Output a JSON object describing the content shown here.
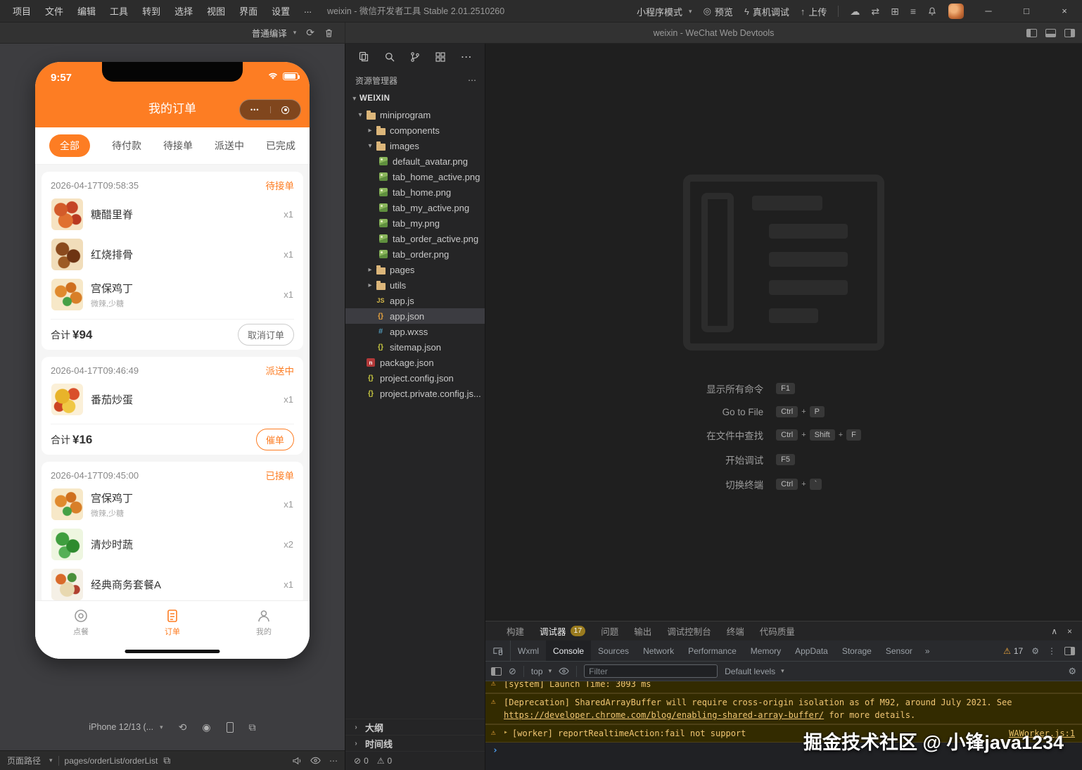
{
  "icons": {
    "chevron_down": "▾",
    "chevron_right": "▸",
    "chevron_small": "›",
    "more_h": "⋯",
    "more_v": "⋮",
    "refresh": "⟳",
    "rotate": "⟲",
    "record": "◉",
    "overlap": "⧉",
    "compare": "⇄",
    "cloud": "☁",
    "grid": "⊞",
    "menu": "≡",
    "minimize": "─",
    "maximize": "□",
    "close": "×",
    "collapse": "∧",
    "preview": "◎",
    "lightning": "ϟ",
    "upload": "↑",
    "warning": "⚠",
    "error": "⊘",
    "block": "⊘",
    "gear": "⚙",
    "more_tabs": "»",
    "prompt": "›",
    "dots": "•••"
  },
  "titlebar": {
    "menus": [
      "项目",
      "文件",
      "编辑",
      "工具",
      "转到",
      "选择",
      "视图",
      "界面",
      "设置",
      "..."
    ],
    "title": "weixin - 微信开发者工具 Stable 2.01.2510260",
    "mode_label": "小程序模式",
    "preview_label": "预览",
    "device_debug_label": "真机调试",
    "upload_label": "上传"
  },
  "toolbar": {
    "compile_mode": "普通编译",
    "devtools_title": "weixin - WeChat Web Devtools"
  },
  "phone": {
    "status_time": "9:57",
    "nav_title": "我的订单",
    "tabs": [
      "全部",
      "待付款",
      "待接单",
      "派送中",
      "已完成"
    ],
    "orders": [
      {
        "time": "2026-04-17T09:58:35",
        "status": "待接单",
        "items": [
          {
            "name": "糖醋里脊",
            "qty": "x1"
          },
          {
            "name": "红烧排骨",
            "qty": "x1"
          },
          {
            "name": "宫保鸡丁",
            "spec": "微辣,少糖",
            "qty": "x1"
          }
        ],
        "total_label": "合计",
        "total_value": "¥94",
        "action": "取消订单"
      },
      {
        "time": "2026-04-17T09:46:49",
        "status": "派送中",
        "items": [
          {
            "name": "番茄炒蛋",
            "qty": "x1"
          }
        ],
        "total_label": "合计",
        "total_value": "¥16",
        "action": "催单"
      },
      {
        "time": "2026-04-17T09:45:00",
        "status": "已接单",
        "items": [
          {
            "name": "宫保鸡丁",
            "spec": "微辣,少糖",
            "qty": "x1"
          },
          {
            "name": "清炒时蔬",
            "qty": "x2"
          },
          {
            "name": "经典商务套餐A",
            "qty": "x1"
          }
        ]
      }
    ],
    "tabbar": [
      {
        "label": "点餐"
      },
      {
        "label": "订单"
      },
      {
        "label": "我的"
      }
    ]
  },
  "sim_footer": {
    "device": "iPhone 12/13 (..."
  },
  "statusbar": {
    "path_label": "页面路径",
    "path_value": "pages/orderList/orderList"
  },
  "explorer": {
    "title": "资源管理器",
    "root": "WEIXIN",
    "items": [
      {
        "label": "miniprogram"
      },
      {
        "label": "components"
      },
      {
        "label": "images"
      },
      {
        "label": "default_avatar.png"
      },
      {
        "label": "tab_home_active.png"
      },
      {
        "label": "tab_home.png"
      },
      {
        "label": "tab_my_active.png"
      },
      {
        "label": "tab_my.png"
      },
      {
        "label": "tab_order_active.png"
      },
      {
        "label": "tab_order.png"
      },
      {
        "label": "pages"
      },
      {
        "label": "utils"
      },
      {
        "label": "app.js"
      },
      {
        "label": "app.json"
      },
      {
        "label": "app.wxss"
      },
      {
        "label": "sitemap.json"
      },
      {
        "label": "package.json"
      },
      {
        "label": "project.config.json"
      },
      {
        "label": "project.private.config.js..."
      }
    ],
    "outline_label": "大纲",
    "timeline_label": "时间线",
    "error_count": "0",
    "warning_count": "0"
  },
  "welcome": {
    "key_sep": "+",
    "shortcuts": [
      {
        "label": "显示所有命令",
        "keys": [
          "F1"
        ]
      },
      {
        "label": "Go to File",
        "keys": [
          "Ctrl",
          "P"
        ]
      },
      {
        "label": "在文件中查找",
        "keys": [
          "Ctrl",
          "Shift",
          "F"
        ]
      },
      {
        "label": "开始调试",
        "keys": [
          "F5"
        ]
      },
      {
        "label": "切换终端",
        "keys": [
          "Ctrl",
          "`"
        ]
      }
    ]
  },
  "debug": {
    "tabs": [
      "构建",
      "调试器",
      "问题",
      "输出",
      "调试控制台",
      "终端",
      "代码质量"
    ],
    "badge": "17",
    "devtools_tabs": [
      "Wxml",
      "Console",
      "Sources",
      "Network",
      "Performance",
      "Memory",
      "AppData",
      "Storage",
      "Sensor"
    ],
    "warn_count": "17",
    "context_label": "top",
    "filter_placeholder": "Filter",
    "levels_label": "Default levels",
    "console": {
      "line0": "[system] Launch Time: 3093 ms",
      "warn1_pre": "[Deprecation] SharedArrayBuffer will require cross-origin isolation as of M92, around July 2021. See ",
      "warn1_link": "https://developer.chrome.com/blog/enabling-shared-array-buffer/",
      "warn1_post": " for more details.",
      "warn2_text": "[worker] reportRealtimeAction:fail not support",
      "warn2_source": "WAWorker.js:1"
    }
  },
  "watermark": "掘金技术社区 @ 小锋java1234"
}
